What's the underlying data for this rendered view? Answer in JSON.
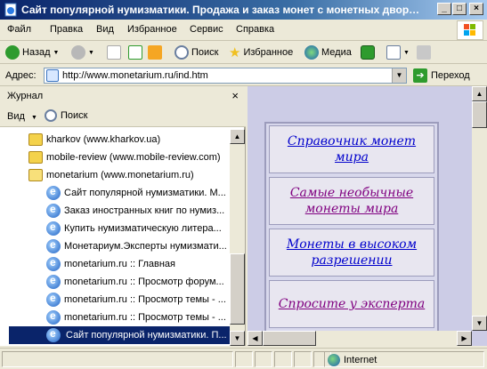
{
  "window": {
    "title": "Сайт популярной нумизматики. Продажа и заказ монет с монетных дворов м...",
    "minimize": "_",
    "maximize": "□",
    "close": "×"
  },
  "menu": [
    "Файл",
    "Правка",
    "Вид",
    "Избранное",
    "Сервис",
    "Справка"
  ],
  "toolbar": {
    "back_label": "Назад",
    "search_label": "Поиск",
    "favorites_label": "Избранное",
    "media_label": "Медиа"
  },
  "address": {
    "label": "Адрес:",
    "url": "http://www.monetarium.ru/ind.htm",
    "go_label": "Переход"
  },
  "history_pane": {
    "title": "Журнал",
    "close": "×",
    "view_label": "Вид",
    "search_label": "Поиск",
    "items": [
      {
        "label": "kharkov (www.kharkov.ua)",
        "kind": "folder",
        "level": 0
      },
      {
        "label": "mobile-review (www.mobile-review.com)",
        "kind": "folder",
        "level": 0
      },
      {
        "label": "monetarium (www.monetarium.ru)",
        "kind": "folder-open",
        "level": 0
      },
      {
        "label": "Сайт популярной нумизматики. М...",
        "kind": "page",
        "level": 1
      },
      {
        "label": "Заказ иностранных книг по нумиз...",
        "kind": "page",
        "level": 1
      },
      {
        "label": "Купить нумизматическую литера...",
        "kind": "page",
        "level": 1
      },
      {
        "label": "Монетариум.Эксперты нумизмати...",
        "kind": "page",
        "level": 1
      },
      {
        "label": "monetarium.ru :: Главная",
        "kind": "page",
        "level": 1
      },
      {
        "label": "monetarium.ru :: Просмотр форум...",
        "kind": "page",
        "level": 1
      },
      {
        "label": "monetarium.ru :: Просмотр темы - ...",
        "kind": "page",
        "level": 1
      },
      {
        "label": "monetarium.ru :: Просмотр темы - ...",
        "kind": "page",
        "level": 1
      },
      {
        "label": "Сайт популярной нумизматики. П...",
        "kind": "page",
        "level": 1,
        "selected": true
      }
    ]
  },
  "content": {
    "links": [
      {
        "text": "Справочник монет мира",
        "color": "#0000cc"
      },
      {
        "text": "Самые необычные монеты мира",
        "color": "#800080"
      },
      {
        "text": "Монеты в высоком разрешении",
        "color": "#0000cc"
      },
      {
        "text": "Спросите у эксперта",
        "color": "#800080"
      }
    ]
  },
  "status": {
    "zone": "Internet"
  }
}
